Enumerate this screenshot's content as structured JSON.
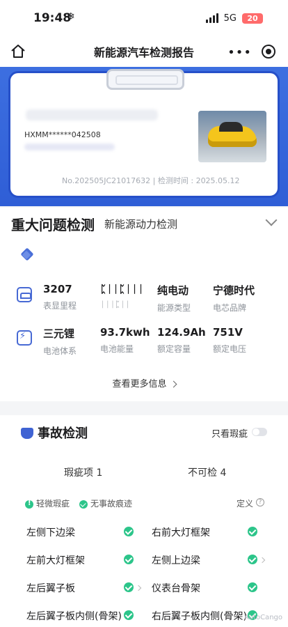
{
  "status": {
    "time": "19:48",
    "extra_icon": "snowflake-icon",
    "network": "5G",
    "battery": "20"
  },
  "nav": {
    "title": "新能源汽车检测报告",
    "more": "•••"
  },
  "card": {
    "plate": "HXMM******042508",
    "report_line": "No.202505JC21017632 | 检测时间 : 2025.05.12"
  },
  "section": {
    "main_tab": "重大问题检测",
    "sub_tab": "新能源动力检测"
  },
  "specs": [
    {
      "value": "3207",
      "label": "表显里程"
    },
    {
      "value": "ᛈᛁᛁᛈᛁᛁᛁ",
      "label": "ᛁᛁᛁᛈᛁᛁ"
    },
    {
      "value": "纯电动",
      "label": "能源类型"
    },
    {
      "value": "宁德时代",
      "label": "电芯品牌"
    },
    {
      "value": "三元锂",
      "label": "电池体系"
    },
    {
      "value": "93.7kwh",
      "label": "电池能量"
    },
    {
      "value": "124.9Ah",
      "label": "额定容量"
    },
    {
      "value": "751V",
      "label": "额定电压"
    }
  ],
  "more_info": "查看更多信息",
  "accident": {
    "title": "事故检测",
    "only_defects": "只看瑕疵",
    "tab_defects": "瑕疵项 1",
    "tab_uncheckable": "不可检 4",
    "legend_minor": "轻微瑕疵",
    "legend_none": "无事故痕迹",
    "define": "定义",
    "items": [
      "左侧下边梁",
      "右前大灯框架",
      "左前大灯框架",
      "左侧上边梁",
      "左后翼子板",
      "仪表台骨架",
      "左后翼子板内侧(骨架)",
      "右后翼子板内侧(骨架)"
    ]
  },
  "watermark": "AutoCango"
}
